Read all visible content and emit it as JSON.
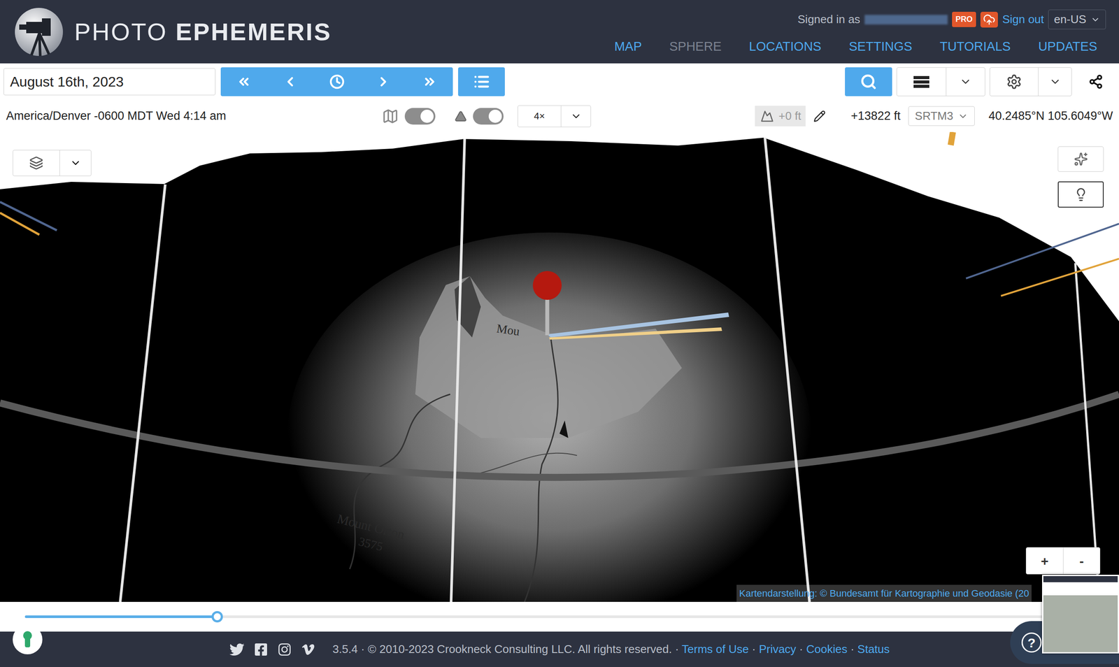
{
  "header": {
    "brand": {
      "light": "PHOTO",
      "bold": "EPHEMERIS"
    },
    "account": {
      "signed_in_label": "Signed in as",
      "badge": "PRO",
      "sign_out": "Sign out",
      "language": "en-US"
    },
    "nav": [
      {
        "label": "MAP",
        "disabled": false
      },
      {
        "label": "SPHERE",
        "disabled": true
      },
      {
        "label": "LOCATIONS",
        "disabled": false
      },
      {
        "label": "SETTINGS",
        "disabled": false
      },
      {
        "label": "TUTORIALS",
        "disabled": false
      },
      {
        "label": "UPDATES",
        "disabled": false
      }
    ]
  },
  "toolbar": {
    "date": "August 16th, 2023"
  },
  "info_bar": {
    "timezone": "America/Denver -0600 MDT Wed 4:14 am",
    "map_toggle": {
      "on": true
    },
    "terrain_toggle": {
      "on": true
    },
    "zoom_factor": "4×",
    "elevation_offset": "+0 ft",
    "elevation": "+13822 ft",
    "dem": "SRTM3",
    "coordinates": "40.2485°N 105.6049°W"
  },
  "map": {
    "labels": [
      {
        "text": "Mou"
      },
      {
        "text": "Mount Orton"
      },
      {
        "text": "3575"
      }
    ],
    "zoom_buttons": [
      "+",
      "-"
    ],
    "attribution": "Kartendarstellung: © Bundesamt für Kartographie und Geodasie (20"
  },
  "timeline": {
    "level": 0.18
  },
  "help": {
    "label": "?"
  },
  "footer": {
    "version": "3.5.4 · © 2010-2023 Crookneck Consulting LLC. All rights reserved.",
    "separator": "·",
    "links": [
      "Terms of Use",
      "Privacy",
      "Cookies",
      "Status"
    ]
  }
}
